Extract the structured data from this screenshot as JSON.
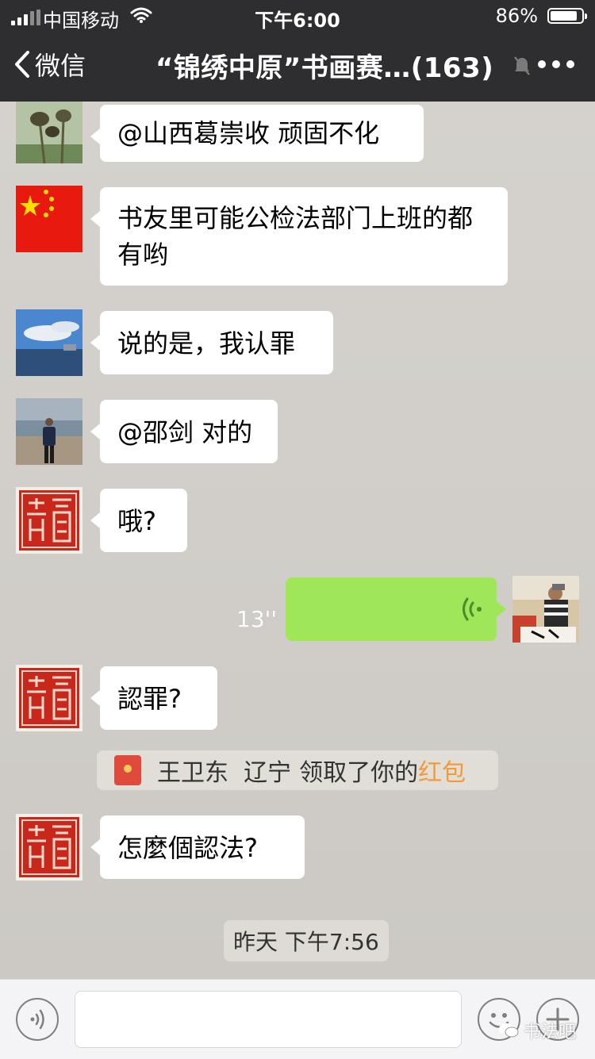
{
  "status_bar": {
    "carrier": "中国移动",
    "time": "下午6:00",
    "battery_percent": "86%",
    "battery_level": 0.86
  },
  "nav": {
    "back_label": "微信",
    "title": "“锦绣中原”书画赛…(163)"
  },
  "messages": [
    {
      "avatar": "lotus-pods-photo",
      "text": "@山西葛崇收 顽固不化"
    },
    {
      "avatar": "china-flag",
      "text": "书友里可能公检法部门上班的都有哟"
    },
    {
      "avatar": "seaside-photo",
      "text": "说的是，我认罪"
    },
    {
      "avatar": "person-at-beach-photo",
      "text": "@邵剑 对的"
    },
    {
      "avatar": "red-seal-stamp",
      "text": "哦?"
    },
    {
      "avatar": "calligrapher-photo",
      "type": "voice",
      "duration": "13''"
    },
    {
      "avatar": "red-seal-stamp",
      "text": "認罪?"
    },
    {
      "type": "system",
      "name": "王卫东  辽宁",
      "action": "领取了你的",
      "highlight": "红包"
    },
    {
      "avatar": "red-seal-stamp",
      "text": "怎麼個認法?"
    }
  ],
  "timestamp": "昨天 下午7:56",
  "watermark": "书法吧",
  "colors": {
    "nav_bg": "#2e2e31",
    "sent_bubble": "#9fe658",
    "red_packet": "#e04a3c",
    "highlight": "#f29a38"
  }
}
